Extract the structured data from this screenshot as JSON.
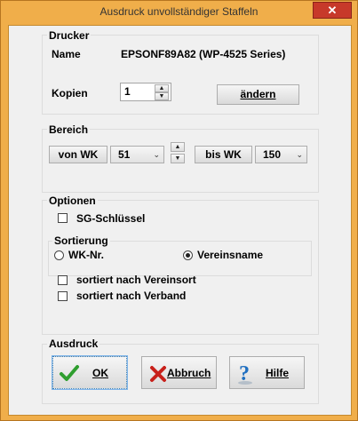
{
  "window": {
    "title": "Ausdruck unvollständiger Staffeln",
    "close_glyph": "✕"
  },
  "drucker": {
    "group_title": "Drucker",
    "name_label": "Name",
    "name_value": "EPSONF89A82 (WP-4525 Series)",
    "kopien_label": "Kopien",
    "kopien_value": "1",
    "aendern_label": "ändern"
  },
  "bereich": {
    "group_title": "Bereich",
    "von_label": "von WK",
    "von_value": "51",
    "bis_label": "bis WK",
    "bis_value": "150"
  },
  "optionen": {
    "group_title": "Optionen",
    "sg_label": "SG-Schlüssel",
    "sortierung_title": "Sortierung",
    "radio_wk_label": "WK-Nr.",
    "radio_verein_label": "Vereinsname",
    "sort_ort_label": "sortiert nach Vereinsort",
    "sort_verband_label": "sortiert nach Verband"
  },
  "ausdruck": {
    "group_title": "Ausdruck",
    "ok_label": "OK",
    "abbruch_label": "Abbruch",
    "hilfe_label": "Hilfe"
  },
  "colors": {
    "accent_frame": "#f0ae4a",
    "close_red": "#c7392a"
  }
}
